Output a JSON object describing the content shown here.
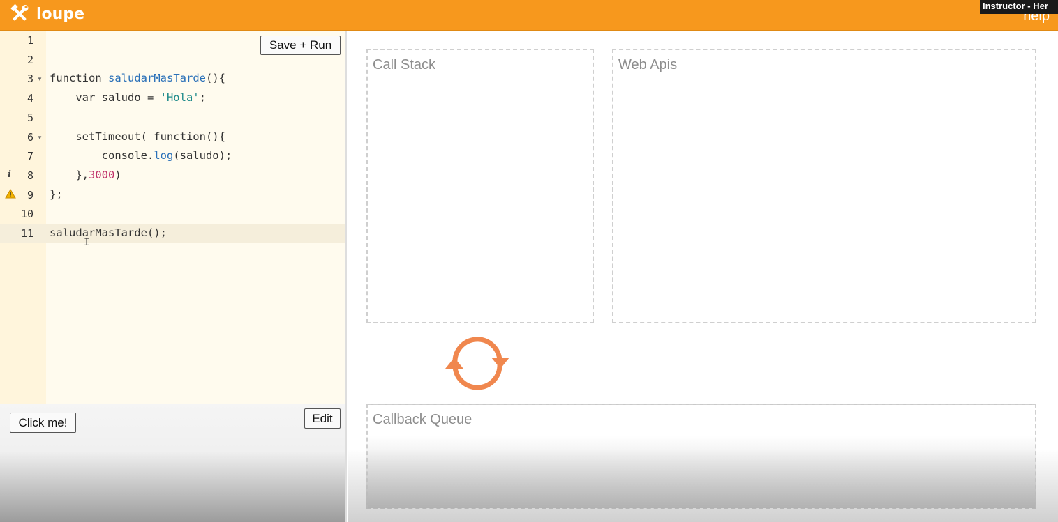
{
  "app": {
    "title": "loupe",
    "help_label": "help",
    "overlay_label": "Instructor - Her"
  },
  "editor": {
    "save_run_label": "Save + Run",
    "lines": [
      {
        "n": "1",
        "text": ""
      },
      {
        "n": "2",
        "text": ""
      },
      {
        "n": "3",
        "text": "function saludarMasTarde(){"
      },
      {
        "n": "4",
        "text": "    var saludo = 'Hola';"
      },
      {
        "n": "5",
        "text": ""
      },
      {
        "n": "6",
        "text": "    setTimeout( function(){"
      },
      {
        "n": "7",
        "text": "        console.log(saludo);"
      },
      {
        "n": "8",
        "text": "    },3000)"
      },
      {
        "n": "9",
        "text": "};"
      },
      {
        "n": "10",
        "text": ""
      },
      {
        "n": "11",
        "text": "saludarMasTarde();"
      }
    ],
    "fold_markers": [
      "3",
      "6"
    ],
    "gutter_markers": {
      "8": "info",
      "9": "warning"
    },
    "active_line": "11"
  },
  "controls": {
    "click_me_label": "Click me!",
    "edit_label": "Edit"
  },
  "panels": {
    "call_stack_title": "Call Stack",
    "web_apis_title": "Web Apis",
    "callback_queue_title": "Callback Queue"
  },
  "icons": {
    "logo": "hammer-wrench-icon",
    "event_loop": "refresh-cycle-icon"
  },
  "colors": {
    "topbar": "#f7981d",
    "loop_icon": "#f0874e",
    "editor_bg": "#fffbee",
    "gutter_bg": "#fff5dc"
  }
}
